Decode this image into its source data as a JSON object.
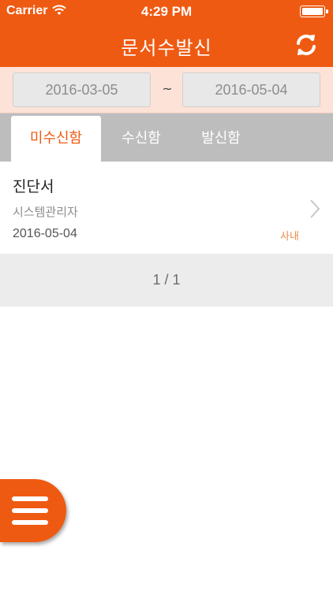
{
  "status_bar": {
    "carrier": "Carrier",
    "time": "4:29 PM"
  },
  "nav": {
    "title": "문서수발신",
    "refresh_icon": "refresh-icon"
  },
  "date_range": {
    "start": "2016-03-05",
    "separator": "~",
    "end": "2016-05-04"
  },
  "tabs": [
    {
      "label": "미수신함",
      "active": true
    },
    {
      "label": "수신함",
      "active": false
    },
    {
      "label": "발신함",
      "active": false
    }
  ],
  "list": {
    "items": [
      {
        "title": "진단서",
        "sender": "시스템관리자",
        "date": "2016-05-04",
        "badge": "사내"
      }
    ]
  },
  "pagination": {
    "label": "1 / 1"
  },
  "menu_button": {
    "icon": "hamburger-menu-icon"
  },
  "colors": {
    "accent": "#ef5a12",
    "date_bar_bg": "#fde3d7",
    "tab_bar_bg": "#bdbdbd",
    "badge": "#ef8a4a"
  }
}
